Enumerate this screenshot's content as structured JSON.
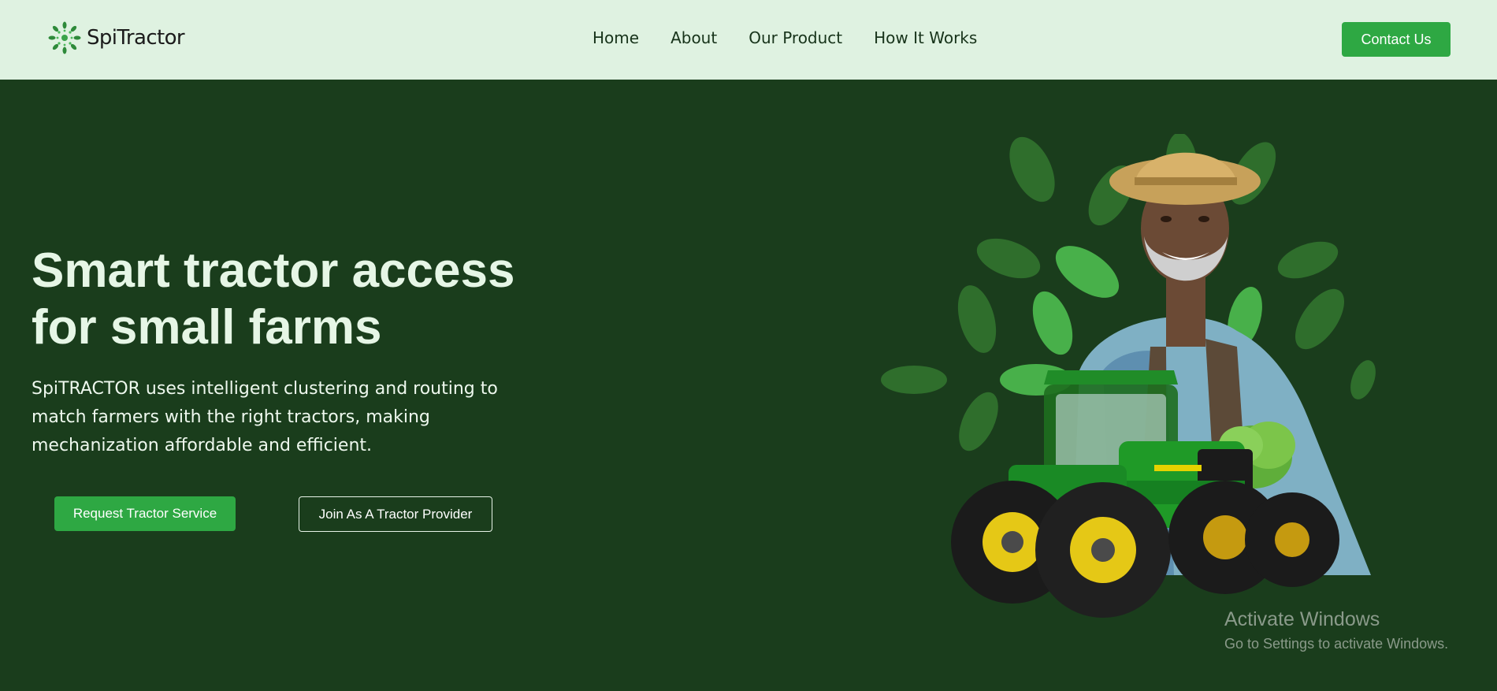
{
  "brand": {
    "name": "SpiTractor",
    "logo_icon": "leaf-wreath-icon",
    "color": "#2ea843"
  },
  "nav": {
    "items": [
      "Home",
      "About",
      "Our Product",
      "How It Works"
    ]
  },
  "header": {
    "contact_label": "Contact Us"
  },
  "hero": {
    "title_line1": "Smart tractor access",
    "title_line2": "for small farms",
    "description": "SpiTRACTOR uses intelligent clustering and routing to match farmers with the right tractors, making mechanization affordable and efficient.",
    "primary_button": "Request Tractor Service",
    "secondary_button": "Join As A Tractor Provider",
    "background_color": "#1a3d1c",
    "image": "farmer-with-green-tractor"
  },
  "watermark": {
    "title": "Activate Windows",
    "subtitle": "Go to Settings to activate Windows."
  }
}
